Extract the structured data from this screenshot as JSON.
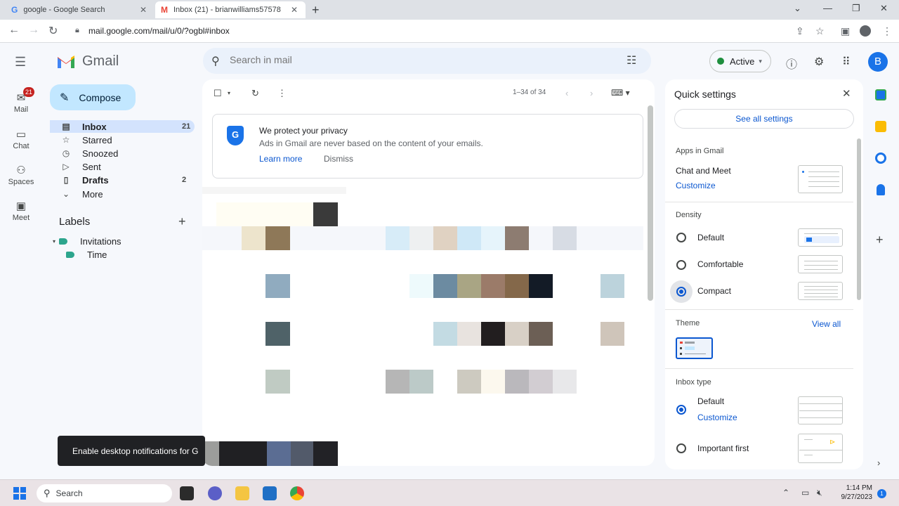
{
  "browser": {
    "tabs": [
      {
        "title": "google - Google Search",
        "favicon": "google-favicon"
      },
      {
        "title": "Inbox (21) - brianwilliams57578",
        "favicon": "gmail-favicon"
      }
    ],
    "url": "mail.google.com/mail/u/0/?ogbl#inbox"
  },
  "gmail": {
    "app_name": "Gmail",
    "search_placeholder": "Search in mail",
    "status": "Active",
    "avatar_letter": "B",
    "rail": [
      {
        "label": "Mail",
        "badge": "21",
        "icon": "mail-icon"
      },
      {
        "label": "Chat",
        "icon": "chat-icon"
      },
      {
        "label": "Spaces",
        "icon": "spaces-icon"
      },
      {
        "label": "Meet",
        "icon": "meet-icon"
      }
    ],
    "compose_label": "Compose",
    "nav": [
      {
        "label": "Inbox",
        "count": "21",
        "icon": "inbox-icon"
      },
      {
        "label": "Starred",
        "count": "",
        "icon": "star-icon"
      },
      {
        "label": "Snoozed",
        "count": "",
        "icon": "clock-icon"
      },
      {
        "label": "Sent",
        "count": "",
        "icon": "send-icon"
      },
      {
        "label": "Drafts",
        "count": "2",
        "icon": "draft-icon"
      },
      {
        "label": "More",
        "count": "",
        "icon": "chevron-down-icon"
      }
    ],
    "labels_heading": "Labels",
    "labels": [
      {
        "name": "Invitations",
        "color": "#2da58d"
      },
      {
        "name": "Time",
        "color": "#2da58d"
      }
    ],
    "pager": "1–34 of 34",
    "privacy": {
      "title": "We protect your privacy",
      "text": "Ads in Gmail are never based on the content of your emails.",
      "learn_more": "Learn more",
      "dismiss": "Dismiss"
    },
    "toast": "Enable desktop notifications for G"
  },
  "quick_settings": {
    "title": "Quick settings",
    "see_all": "See all settings",
    "apps_heading": "Apps in Gmail",
    "apps_item": "Chat and Meet",
    "apps_customize": "Customize",
    "density_heading": "Density",
    "density_options": [
      {
        "label": "Default",
        "selected": false
      },
      {
        "label": "Comfortable",
        "selected": false
      },
      {
        "label": "Compact",
        "selected": true
      }
    ],
    "theme_heading": "Theme",
    "theme_view_all": "View all",
    "inbox_type_heading": "Inbox type",
    "inbox_type_options": [
      {
        "label": "Default",
        "selected": true
      },
      {
        "label": "Important first",
        "selected": false
      }
    ],
    "inbox_type_customize": "Customize"
  },
  "taskbar": {
    "search": "Search",
    "time": "1:14 PM",
    "date": "9/27/2023",
    "notifications": "1"
  },
  "colors": {
    "accent": "#0b57d0",
    "compose_bg": "#c2e7ff",
    "active_nav": "#d3e3fd",
    "badge": "#c5221f"
  }
}
